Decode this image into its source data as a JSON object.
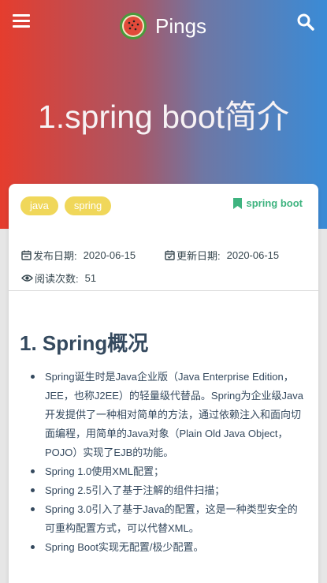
{
  "header": {
    "brand_name": "Pings",
    "menu_icon": "hamburger-menu-icon",
    "search_icon": "search-icon",
    "logo": "watermelon-logo"
  },
  "post": {
    "title": "1.spring boot简介",
    "tags": [
      "java",
      "spring"
    ],
    "category": "spring boot",
    "published_label": "发布日期:",
    "published_value": "2020-06-15",
    "updated_label": "更新日期:",
    "updated_value": "2020-06-15",
    "views_label": "阅读次数:",
    "views_value": "51"
  },
  "article": {
    "heading": "1. Spring概况",
    "bullets": [
      "Spring诞生时是Java企业版（Java Enterprise Edition，JEE，也称J2EE）的轻量级代替品。Spring为企业级Java开发提供了一种相对简单的方法，通过依赖注入和面向切面编程，用简单的Java对象（Plain Old Java Object， POJO）实现了EJB的功能。",
      "Spring 1.0使用XML配置；",
      "Spring 2.5引入了基于注解的组件扫描；",
      "Spring 3.0引入了基于Java的配置，这是一种类型安全的可重构配置方式，可以代替XML。",
      "Spring Boot实现无配置/极少配置。"
    ]
  },
  "colors": {
    "tag_bg": "#f0d75a",
    "category": "#3eb37f",
    "heading": "#34495e"
  }
}
